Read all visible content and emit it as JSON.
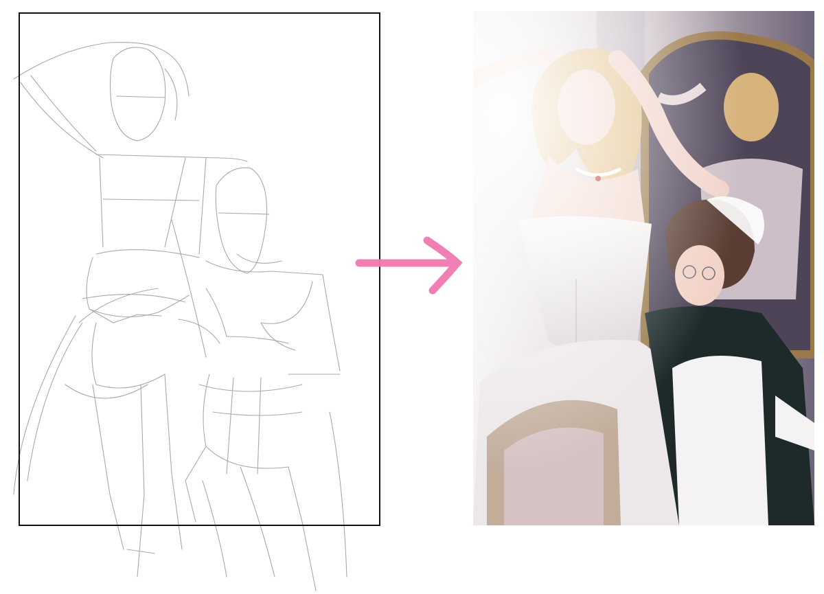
{
  "canvas": {
    "background": "#ffffff"
  },
  "sketch_panel": {
    "frame_color": "#111111",
    "line_color": "#9a9a9a"
  },
  "arrow": {
    "icon": "arrow-right-icon",
    "color": "#f07ab0"
  },
  "painting_panel": {
    "palette": {
      "background": "#cfc4c8",
      "mirror_frame": "#9b7a4a",
      "dress": "#f2eeee",
      "hair_blonde": "#e3c18a",
      "hair_brown": "#5a3e33",
      "maid_dress": "#1e2a2a",
      "skin": "#f4d8cf"
    },
    "signature_text": ""
  }
}
